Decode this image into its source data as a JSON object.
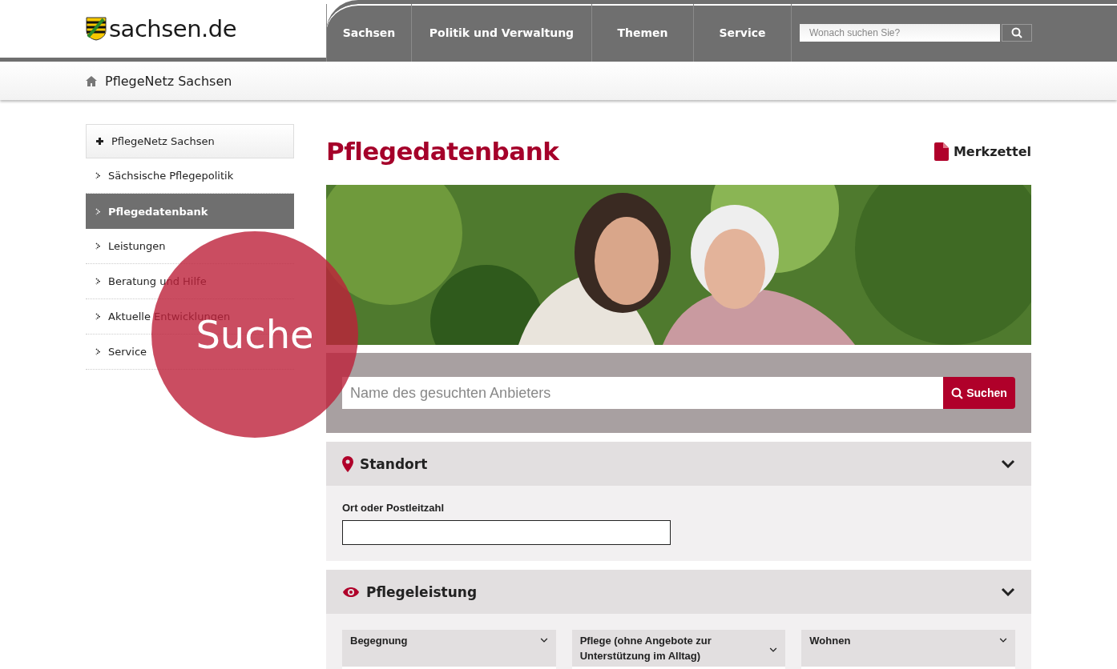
{
  "header": {
    "logo": "sachsen.de",
    "nav": [
      {
        "label": "Sachsen"
      },
      {
        "label": "Politik und Verwaltung"
      },
      {
        "label": "Themen"
      },
      {
        "label": "Service"
      }
    ],
    "search": {
      "placeholder": "Wonach suchen Sie?"
    }
  },
  "breadcrumb": "PflegeNetz Sachsen",
  "sidebar": {
    "items": [
      {
        "label": "PflegeNetz Sachsen",
        "kind": "parent",
        "selected": false
      },
      {
        "label": "Sächsische Pflegepolitik",
        "kind": "child",
        "selected": false
      },
      {
        "label": "Pflegedatenbank",
        "kind": "child",
        "selected": true
      },
      {
        "label": "Leistungen",
        "kind": "child",
        "selected": false
      },
      {
        "label": "Beratung und Hilfe",
        "kind": "child",
        "selected": false
      },
      {
        "label": "Aktuelle Entwicklungen",
        "kind": "child",
        "selected": false
      },
      {
        "label": "Service",
        "kind": "child",
        "selected": false
      }
    ]
  },
  "overlay": {
    "label": "Suche"
  },
  "page": {
    "title": "Pflegedatenbank",
    "notepad": "Merkzettel",
    "search": {
      "placeholder": "Name des gesuchten Anbieters",
      "button": "Suchen"
    },
    "sections": [
      {
        "title": "Standort",
        "kind": "location",
        "expanded": true,
        "field_label": "Ort oder Postleitzahl"
      },
      {
        "title": "Pflegeleistung",
        "kind": "service",
        "expanded": true,
        "selects": [
          "Begegnung",
          "Pflege (ohne Angebote zur Unterstützung im Alltag)",
          "Wohnen"
        ]
      }
    ]
  }
}
